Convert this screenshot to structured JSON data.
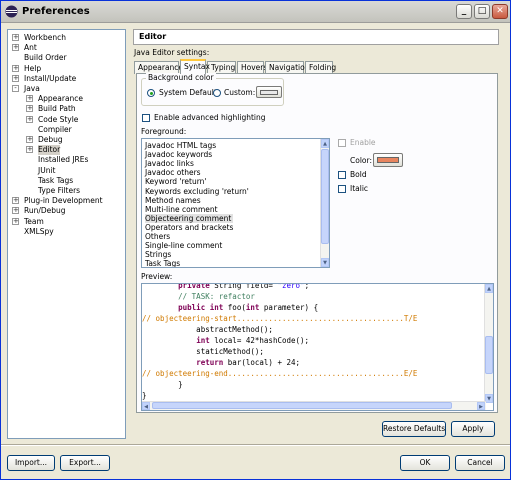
{
  "window": {
    "title": "Preferences",
    "controls": [
      "minimize",
      "maximize",
      "close"
    ]
  },
  "tree": {
    "items": [
      {
        "label": "Workbench",
        "expander": "+"
      },
      {
        "label": "Ant",
        "expander": "+"
      },
      {
        "label": "Build Order",
        "expander": ""
      },
      {
        "label": "Help",
        "expander": "+"
      },
      {
        "label": "Install/Update",
        "expander": "+"
      },
      {
        "label": "Java",
        "expander": "-"
      },
      {
        "label": "Appearance",
        "expander": "+"
      },
      {
        "label": "Build Path",
        "expander": "+"
      },
      {
        "label": "Code Style",
        "expander": "+"
      },
      {
        "label": "Compiler",
        "expander": ""
      },
      {
        "label": "Debug",
        "expander": "+"
      },
      {
        "label": "Editor",
        "expander": "+"
      },
      {
        "label": "Installed JREs",
        "expander": ""
      },
      {
        "label": "JUnit",
        "expander": ""
      },
      {
        "label": "Task Tags",
        "expander": ""
      },
      {
        "label": "Type Filters",
        "expander": ""
      },
      {
        "label": "Plug-in Development",
        "expander": "+"
      },
      {
        "label": "Run/Debug",
        "expander": "+"
      },
      {
        "label": "Team",
        "expander": "+"
      },
      {
        "label": "XMLSpy",
        "expander": ""
      }
    ],
    "selected": "Editor"
  },
  "panel": {
    "title": "Editor",
    "settings_label": "Java Editor settings:",
    "tabs": [
      "Appearance",
      "Syntax",
      "Typing",
      "Hovers",
      "Navigation",
      "Folding"
    ],
    "active_tab": "Syntax",
    "background": {
      "group_title": "Background color",
      "system_default_label": "System Default",
      "custom_label": "Custom:",
      "selected": "System Default"
    },
    "advanced_highlighting_label": "Enable advanced highlighting",
    "foreground_label": "Foreground:",
    "foreground_items": [
      "Javadoc HTML tags",
      "Javadoc keywords",
      "Javadoc links",
      "Javadoc others",
      "Keyword 'return'",
      "Keywords excluding 'return'",
      "Method names",
      "Multi-line comment",
      "Objecteering comment",
      "Operators and brackets",
      "Others",
      "Single-line comment",
      "Strings",
      "Task Tags"
    ],
    "foreground_selected": "Objecteering comment",
    "enable_label": "Enable",
    "color_label": "Color:",
    "bold_label": "Bold",
    "italic_label": "Italic",
    "selected_color": "#e8855f",
    "preview_label": "Preview:",
    "preview_lines": [
      {
        "segments": [
          {
            "t": "        ",
            "c": ""
          },
          {
            "t": "private",
            "c": "kw"
          },
          {
            "t": " String field= ",
            "c": ""
          },
          {
            "t": "\"zero\"",
            "c": "st"
          },
          {
            "t": ";",
            "c": ""
          }
        ]
      },
      {
        "segments": [
          {
            "t": "        ",
            "c": ""
          },
          {
            "t": "// TASK: refactor",
            "c": "cm"
          }
        ]
      },
      {
        "segments": [
          {
            "t": "        ",
            "c": ""
          },
          {
            "t": "public",
            "c": "kw"
          },
          {
            "t": " ",
            "c": ""
          },
          {
            "t": "int",
            "c": "kw"
          },
          {
            "t": " foo(",
            "c": ""
          },
          {
            "t": "int",
            "c": "kw"
          },
          {
            "t": " parameter) {",
            "c": ""
          }
        ]
      },
      {
        "segments": [
          {
            "t": "// objecteering-start.....................................T/E",
            "c": "ot"
          }
        ]
      },
      {
        "segments": [
          {
            "t": "            abstractMethod();",
            "c": ""
          }
        ]
      },
      {
        "segments": [
          {
            "t": "            ",
            "c": ""
          },
          {
            "t": "int",
            "c": "kw"
          },
          {
            "t": " local= 42*hashCode();",
            "c": ""
          }
        ]
      },
      {
        "segments": [
          {
            "t": "            staticMethod();",
            "c": ""
          }
        ]
      },
      {
        "segments": [
          {
            "t": "            ",
            "c": ""
          },
          {
            "t": "return",
            "c": "kw"
          },
          {
            "t": " bar(local) + 24;",
            "c": ""
          }
        ]
      },
      {
        "segments": [
          {
            "t": "// objecteering-end.......................................E/E",
            "c": "ot"
          }
        ]
      },
      {
        "segments": [
          {
            "t": "        }",
            "c": ""
          }
        ]
      },
      {
        "segments": [
          {
            "t": "}",
            "c": ""
          }
        ]
      }
    ],
    "restore_defaults_label": "Restore Defaults",
    "apply_label": "Apply"
  },
  "footer": {
    "import_label": "Import...",
    "export_label": "Export...",
    "ok_label": "OK",
    "cancel_label": "Cancel"
  },
  "colors": {
    "keyword": "#7f0055",
    "comment": "#3f7f5f",
    "objecteering": "#d07a00",
    "string": "#2a00ff"
  }
}
